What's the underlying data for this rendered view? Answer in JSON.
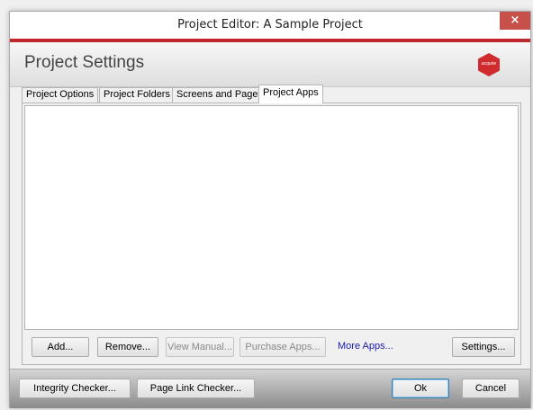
{
  "window": {
    "title": "Project Editor: A Sample Project",
    "close_glyph": "×",
    "accent_color": "#c0282d"
  },
  "header": {
    "title": "Project Settings",
    "logo_text": "acquire",
    "logo_color": "#d02b2e"
  },
  "tabs": [
    {
      "label": "Project Options",
      "active": false
    },
    {
      "label": "Project Folders",
      "active": false
    },
    {
      "label": "Screens and Pages",
      "active": false
    },
    {
      "label": "Project Apps",
      "active": true
    }
  ],
  "apps_panel": {
    "items": [],
    "buttons": {
      "add": "Add...",
      "remove": "Remove...",
      "view_manual": "View Manual...",
      "purchase_apps": "Purchase Apps...",
      "more_apps": "More Apps...",
      "settings": "Settings..."
    }
  },
  "footer": {
    "integrity_checker": "Integrity Checker...",
    "page_link_checker": "Page Link Checker...",
    "ok": "Ok",
    "cancel": "Cancel"
  }
}
